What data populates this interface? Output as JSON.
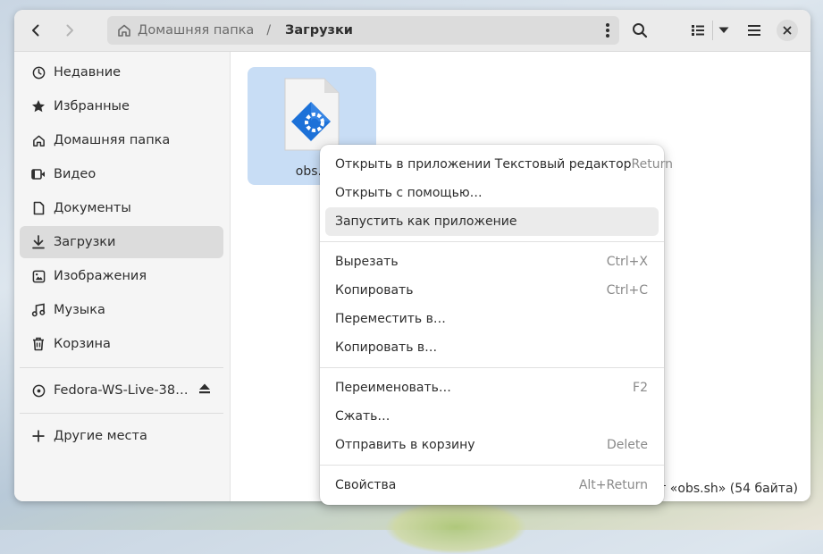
{
  "window": {
    "breadcrumb": {
      "home": "Домашняя папка",
      "separator": "/",
      "current": "Загрузки"
    }
  },
  "sidebar": {
    "items": [
      {
        "label": "Недавние",
        "icon": "clock-icon"
      },
      {
        "label": "Избранные",
        "icon": "star-icon"
      },
      {
        "label": "Домашняя папка",
        "icon": "home-icon"
      },
      {
        "label": "Видео",
        "icon": "video-icon"
      },
      {
        "label": "Документы",
        "icon": "document-icon"
      },
      {
        "label": "Загрузки",
        "icon": "download-icon",
        "selected": true
      },
      {
        "label": "Изображения",
        "icon": "image-icon"
      },
      {
        "label": "Музыка",
        "icon": "music-icon"
      },
      {
        "label": "Корзина",
        "icon": "trash-icon"
      }
    ],
    "drive": {
      "label": "Fedora-WS-Live-38…",
      "icon": "disc-icon"
    },
    "other": {
      "label": "Другие места",
      "icon": "plus-icon"
    }
  },
  "content": {
    "file": {
      "name": "obs.s",
      "icon": "script-file-icon"
    },
    "status": "кт «obs.sh» (54 байта)"
  },
  "context_menu": {
    "section1": [
      {
        "label": "Открыть в приложении Текстовый редактор",
        "accel": "Return"
      },
      {
        "label": "Открыть с помощью…",
        "accel": ""
      },
      {
        "label": "Запустить как приложение",
        "accel": "",
        "hover": true
      }
    ],
    "section2": [
      {
        "label": "Вырезать",
        "accel": "Ctrl+X"
      },
      {
        "label": "Копировать",
        "accel": "Ctrl+C"
      },
      {
        "label": "Переместить в…",
        "accel": ""
      },
      {
        "label": "Копировать в…",
        "accel": ""
      }
    ],
    "section3": [
      {
        "label": "Переименовать…",
        "accel": "F2"
      },
      {
        "label": "Сжать…",
        "accel": ""
      },
      {
        "label": "Отправить в корзину",
        "accel": "Delete"
      }
    ],
    "section4": [
      {
        "label": "Свойства",
        "accel": "Alt+Return"
      }
    ]
  },
  "colors": {
    "selection": "#c8ddf5",
    "accent": "#3584e4",
    "hover": "#ebebeb"
  }
}
